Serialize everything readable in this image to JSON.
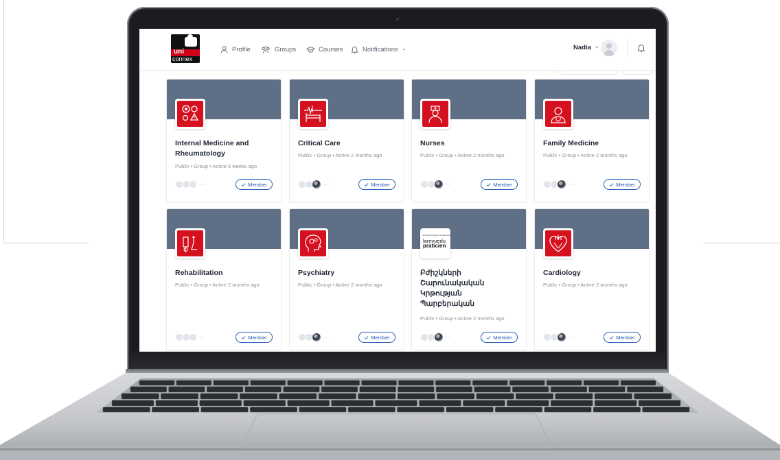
{
  "nav": {
    "logo_line1": "uni",
    "logo_line2": "connex",
    "items": [
      {
        "label": "Profile",
        "icon": "user-icon"
      },
      {
        "label": "Groups",
        "icon": "groups-icon"
      },
      {
        "label": "Courses",
        "icon": "graduation-cap-icon"
      },
      {
        "label": "Notifications",
        "icon": "bell-icon"
      }
    ],
    "user_name": "Nadia",
    "chevron": "⌄"
  },
  "member_label": "Member",
  "meta_separator": "•",
  "dots": "···",
  "cards": [
    {
      "title": "Internal Medicine and Rheumatology",
      "visibility": "Public",
      "type": "Group",
      "activity": "Active 6 weeks ago",
      "icon": "gears-warning-icon"
    },
    {
      "title": "Critical Care",
      "visibility": "Public",
      "type": "Group",
      "activity": "Active 2 months ago",
      "icon": "hospital-bed-icon"
    },
    {
      "title": "Nurses",
      "visibility": "Public",
      "type": "Group",
      "activity": "Active 2 months ago",
      "icon": "nurse-icon"
    },
    {
      "title": "Family Medicine",
      "visibility": "Public",
      "type": "Group",
      "activity": "Active 2 months ago",
      "icon": "doctor-icon"
    },
    {
      "title": "Rehabilitation",
      "visibility": "Public",
      "type": "Group",
      "activity": "Active 2 months ago",
      "icon": "crutches-icon"
    },
    {
      "title": "Psychiatry",
      "visibility": "Public",
      "type": "Group",
      "activity": "Active 2 months ago",
      "icon": "head-gears-icon"
    },
    {
      "title": "Բժիշկների Շարունակական Կրթության Պարբերական",
      "visibility": "Public",
      "type": "Group",
      "activity": "Active 2 months ago",
      "icon": "la-revue-du-praticien-logo",
      "logo_small": "Journal Arménien de Médecine",
      "logo_brand_a": "larevuedu",
      "logo_brand_b": "praticien"
    },
    {
      "title": "Cardiology",
      "visibility": "Public",
      "type": "Group",
      "activity": "Active 2 months ago",
      "icon": "heart-icon"
    }
  ]
}
